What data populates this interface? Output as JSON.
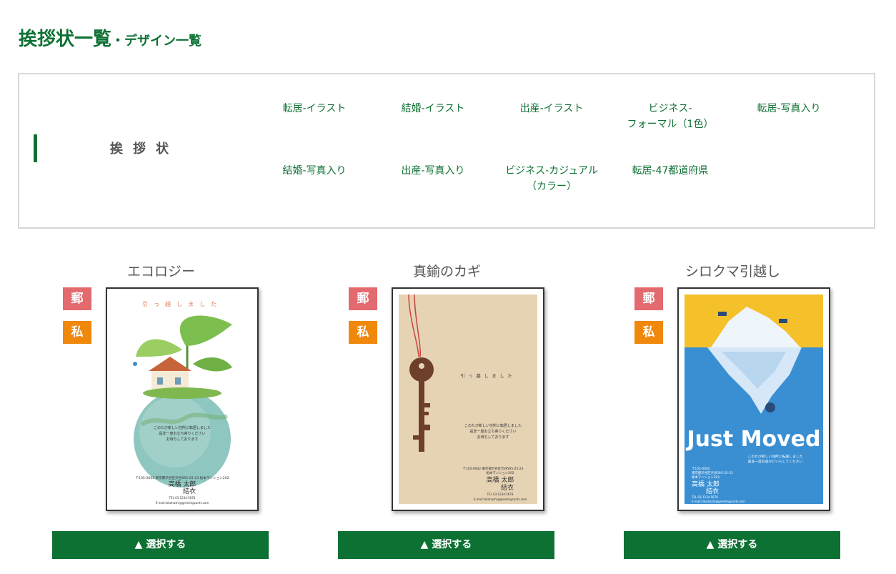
{
  "header": {
    "title": "挨拶状一覧",
    "subtitle": "・デザイン一覧"
  },
  "categories": {
    "label": "挨拶状",
    "links": [
      {
        "label": "転居-イラスト"
      },
      {
        "label": "結婚-イラスト"
      },
      {
        "label": "出産-イラスト"
      },
      {
        "label": "ビジネス-\nフォーマル（1色）"
      },
      {
        "label": "転居-写真入り"
      },
      {
        "label": "結婚-写真入り"
      },
      {
        "label": "出産-写真入り"
      },
      {
        "label": "ビジネス-カジュアル\n（カラー）"
      },
      {
        "label": "転居-47都道府県"
      }
    ]
  },
  "badges": {
    "postcard": "郵",
    "private": "私"
  },
  "designs": [
    {
      "title": "エコロジー",
      "button": "▲ 選択する",
      "card": {
        "heading": "引っ越しました",
        "message": [
          "このたび新しい住所に転居しました",
          "是非一度お立ち寄りください",
          "お待ちしております"
        ],
        "address": [
          "〒105-0002 東京都渋谷区渋谷595-25-23 松本マンション202"
        ],
        "names": [
          "高橋 太郎",
          "結衣"
        ],
        "contact": [
          "TEL 03-1234-5678",
          "E-mail:takahashi@greetingcards.com"
        ]
      }
    },
    {
      "title": "真鍮のカギ",
      "button": "▲ 選択する",
      "card": {
        "heading": "引っ越しました",
        "message": [
          "このたび新しい住所に転居しました",
          "是非一度お立ち寄りください",
          "お待ちしております"
        ],
        "address": [
          "〒105-0002 東京都渋谷区渋谷595-25-23",
          "松本マンション202"
        ],
        "names": [
          "高橋 太郎",
          "結衣"
        ],
        "contact": [
          "TEL 03-1234-5678",
          "E-mail:takahashi@greetingcards.com"
        ]
      }
    },
    {
      "title": "シロクマ引越し",
      "button": "▲ 選択する",
      "card": {
        "heading": "Just Moved",
        "message": [
          "このたび新しい住所に転居しました",
          "是非一度お遊びにいらしてください"
        ],
        "address": [
          "〒105-0002",
          "東京都渋谷区渋谷595-25-23",
          "松本マンション202"
        ],
        "names": [
          "高橋 太郎",
          "結衣"
        ],
        "contact": [
          "TEL 03-1234-5678",
          "E-mail:takahashi@greetingcards.com"
        ]
      }
    }
  ],
  "colors": {
    "brand_green": "#0e7134",
    "badge_postcard": "#e36a6f",
    "badge_private": "#f0880c"
  }
}
